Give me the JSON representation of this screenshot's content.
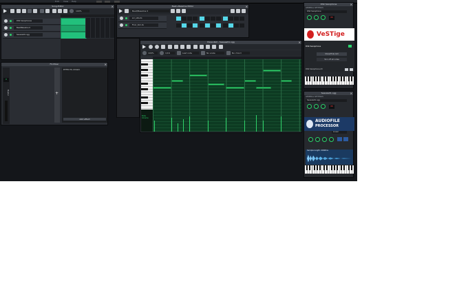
{
  "menu": [
    "Edit",
    "View",
    "Help"
  ],
  "song_editor": {
    "title": "Song-Editor",
    "zoom": "100%",
    "tracks": [
      {
        "name": "DSK Saxophones"
      },
      {
        "name": "Beat/Bassline 0"
      },
      {
        "name": "Seesaw01.ogg"
      }
    ]
  },
  "beat_editor": {
    "title": "Beat+Bassline Editor",
    "selector": "Beat/Bassline 0",
    "tracks": [
      {
        "name": "snr_side.ds"
      },
      {
        "name": "Floor_tom.ds"
      }
    ]
  },
  "fx_mixer": {
    "title": "FX-Mixer",
    "channel_value": "0",
    "master_label": "Master",
    "effects_chain_label": "EFFECTS CHAIN",
    "add_effect_label": "Add effect"
  },
  "piano_roll": {
    "title": "Piano-Roll - Seesaw01.ogg",
    "zoom": "100%",
    "quantize": "1/16",
    "note_length": "Last note",
    "scale": "No scale",
    "chord": "No chord",
    "note_volume_label": "Note Volume"
  },
  "instrument1": {
    "title": "DSK Saxophone",
    "general_settings": "GENERAL SETTINGS",
    "name": "DSK Saxophone",
    "lcd": "00",
    "logo_text": "VeSTige",
    "plugin_name": "DSK Saxophone",
    "open_vst_label": "Show/Hide GUI",
    "turn_off_label": "Turn off all notes",
    "plugin_label": "DSK Saxophone.dll"
  },
  "instrument2": {
    "title": "Seesaw01.ogg",
    "general_settings": "GENERAL SETTINGS",
    "name": "Seesaw01.ogg",
    "lcd": "00",
    "logo_line1": "AUDIOFILE",
    "logo_line2": "PROCESSOR",
    "mode": "Linear",
    "sample_info": "Sample length: 2668ms"
  },
  "colors": {
    "accent_green": "#2ad46b",
    "pattern_green": "#22c07c",
    "step_on": "#55d7e8",
    "lcd_red": "#ff3b3b"
  }
}
